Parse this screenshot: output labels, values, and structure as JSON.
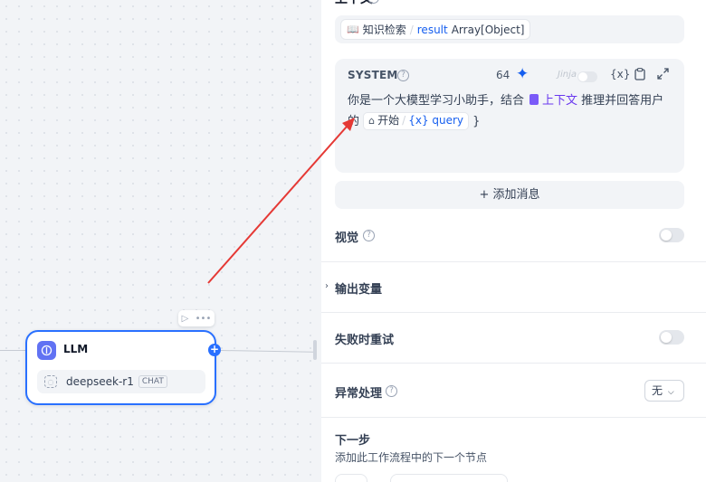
{
  "canvas": {
    "node": {
      "title": "LLM",
      "icon": "llm-brain-icon",
      "model_name": "deepseek-r1",
      "model_badge": "CHAT",
      "play_icon": "▷",
      "more_icon": "•••",
      "plus": "+"
    }
  },
  "panel": {
    "section_title": "上下文",
    "context_chip": {
      "source": "知识检索",
      "variable": "result",
      "type": "Array[Object]"
    },
    "system": {
      "label": "SYSTEM",
      "token_count": "64",
      "jinja_label": "Jinja",
      "text_before": "你是一个大模型学习小助手，结合",
      "context_var": "上下文",
      "text_after": "推理并回答用户的",
      "start_node": "开始",
      "query_var": "{x} query",
      "closing": "}"
    },
    "add_message": "+ 添加消息",
    "vision": {
      "label": "视觉"
    },
    "output_vars": {
      "label": "输出变量"
    },
    "retry": {
      "label": "失败时重试"
    },
    "exception": {
      "label": "异常处理",
      "value": "无"
    },
    "next_step": {
      "title": "下一步",
      "subtitle": "添加此工作流程中的下一个节点"
    }
  },
  "colors": {
    "accent": "#2970ff",
    "variable_blue": "#155eef",
    "context_purple": "#6938ef",
    "annotation_arrow": "#e53935"
  }
}
